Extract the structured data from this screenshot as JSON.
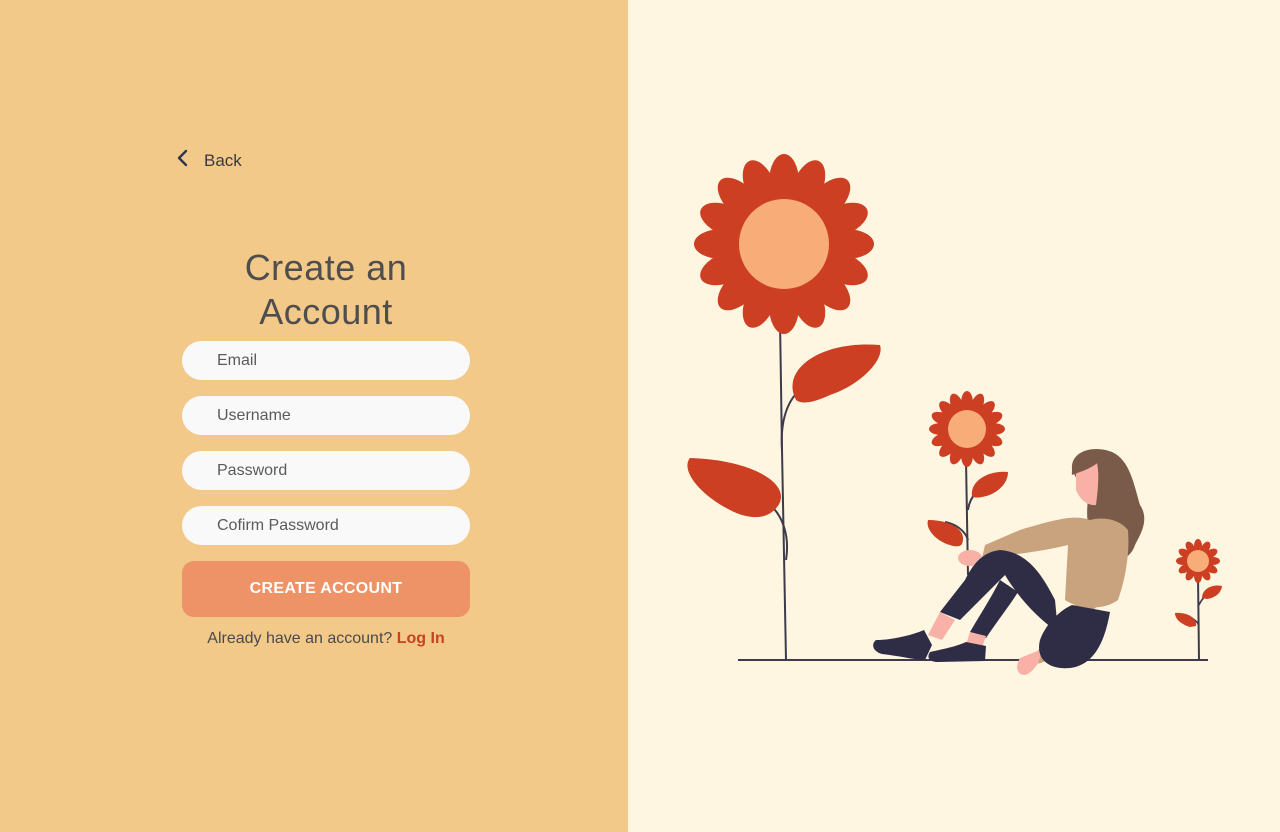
{
  "back": {
    "label": "Back"
  },
  "form": {
    "title_line1": "Create an",
    "title_line2": "Account",
    "email_placeholder": "Email",
    "username_placeholder": "Username",
    "password_placeholder": "Password",
    "confirm_placeholder": "Cofirm Password",
    "submit_label": "CREATE ACCOUNT"
  },
  "login": {
    "prompt": "Already have an account?",
    "link_label": "Log In"
  },
  "colors": {
    "left_bg": "#F3C98A",
    "right_bg": "#FEF6E1",
    "button": "#EE9268",
    "accent": "#C8421F",
    "flower_petal": "#CC3F23",
    "flower_center": "#F8AC78"
  },
  "illustration": {
    "subject": "woman-sitting-with-flowers"
  }
}
